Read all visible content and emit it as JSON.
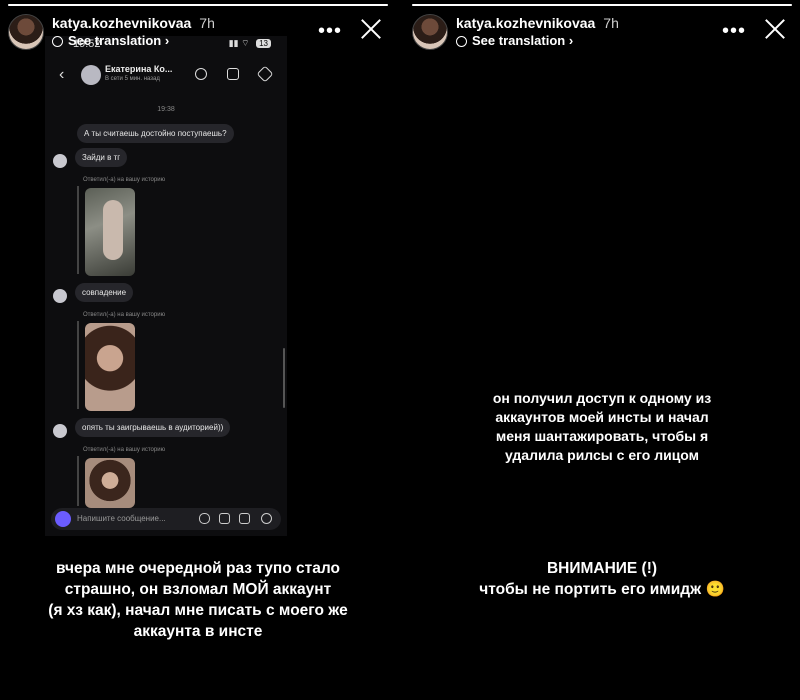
{
  "left": {
    "progress": 1.0,
    "username": "katya.kozhevnikovaa",
    "time": "7h",
    "see_translation": "See translation",
    "inner": {
      "status_time": "19:52",
      "status_battery": "13",
      "contact_name": "Екатерина Ко...",
      "contact_status": "В сети 5 мин. назад",
      "chat_time": "19:38",
      "messages": [
        "А ты считаешь достойно поступаешь?",
        "Зайди в тг",
        "совпадение",
        "опять ты заигрываешь в аудиторией))"
      ],
      "reply_label": "Ответил(-а) на вашу историю",
      "composer_placeholder": "Напишите сообщение..."
    },
    "caption_lines": [
      "вчера мне очередной раз тупо стало",
      "страшно, он взломал МОЙ аккаунт",
      "(я хз как), начал мне писать с моего же",
      "аккаунта в инсте"
    ]
  },
  "right": {
    "progress": 1.0,
    "username": "katya.kozhevnikovaa",
    "time": "7h",
    "see_translation": "See translation",
    "text_block_1": [
      "он получил доступ к одному из",
      "аккаунтов моей инсты и начал",
      "меня шантажировать, чтобы я",
      "удалила рилсы с его лицом"
    ],
    "text_block_2": [
      "ВНИМАНИЕ (!)",
      "чтобы не портить его имидж 🙂"
    ]
  }
}
